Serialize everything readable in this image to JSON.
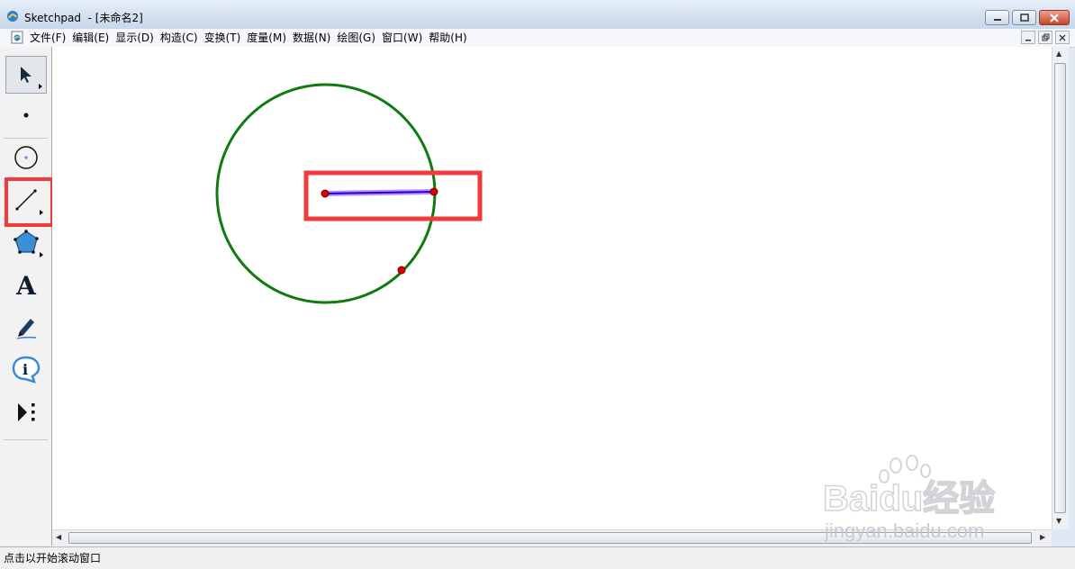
{
  "window": {
    "title": "Sketchpad  - [未命名2]",
    "controls": [
      "minimize-icon",
      "maximize-icon",
      "close-icon"
    ]
  },
  "menubar": {
    "items": [
      "文件(F)",
      "编辑(E)",
      "显示(D)",
      "构造(C)",
      "变换(T)",
      "度量(M)",
      "数据(N)",
      "绘图(G)",
      "窗口(W)",
      "帮助(H)"
    ],
    "doc_controls": [
      "doc-minimize-icon",
      "doc-restore-icon",
      "doc-close-icon"
    ]
  },
  "toolbox": {
    "tools": [
      {
        "name": "arrow-select-tool",
        "icon": "arrow-icon"
      },
      {
        "name": "point-tool",
        "icon": "point-icon"
      },
      {
        "name": "compass-tool",
        "icon": "circle-icon"
      },
      {
        "name": "straightedge-tool",
        "icon": "segment-icon",
        "selected": true
      },
      {
        "name": "polygon-tool",
        "icon": "polygon-icon"
      },
      {
        "name": "text-tool",
        "icon": "text-icon",
        "label": "A"
      },
      {
        "name": "marker-tool",
        "icon": "marker-icon"
      },
      {
        "name": "information-tool",
        "icon": "info-icon",
        "label": "i"
      },
      {
        "name": "custom-tool",
        "icon": "custom-tool-icon"
      }
    ]
  },
  "colors": {
    "circle": "#0f7a0f",
    "segment": "#2200cc",
    "segment_selected": "#b98cff",
    "point": "#e00000",
    "highlight": "#ef3b3b"
  },
  "statusbar": {
    "text": "点击以开始滚动窗口"
  },
  "watermark": {
    "brand": "Baidu经验",
    "url": "jingyan.baidu.com"
  }
}
